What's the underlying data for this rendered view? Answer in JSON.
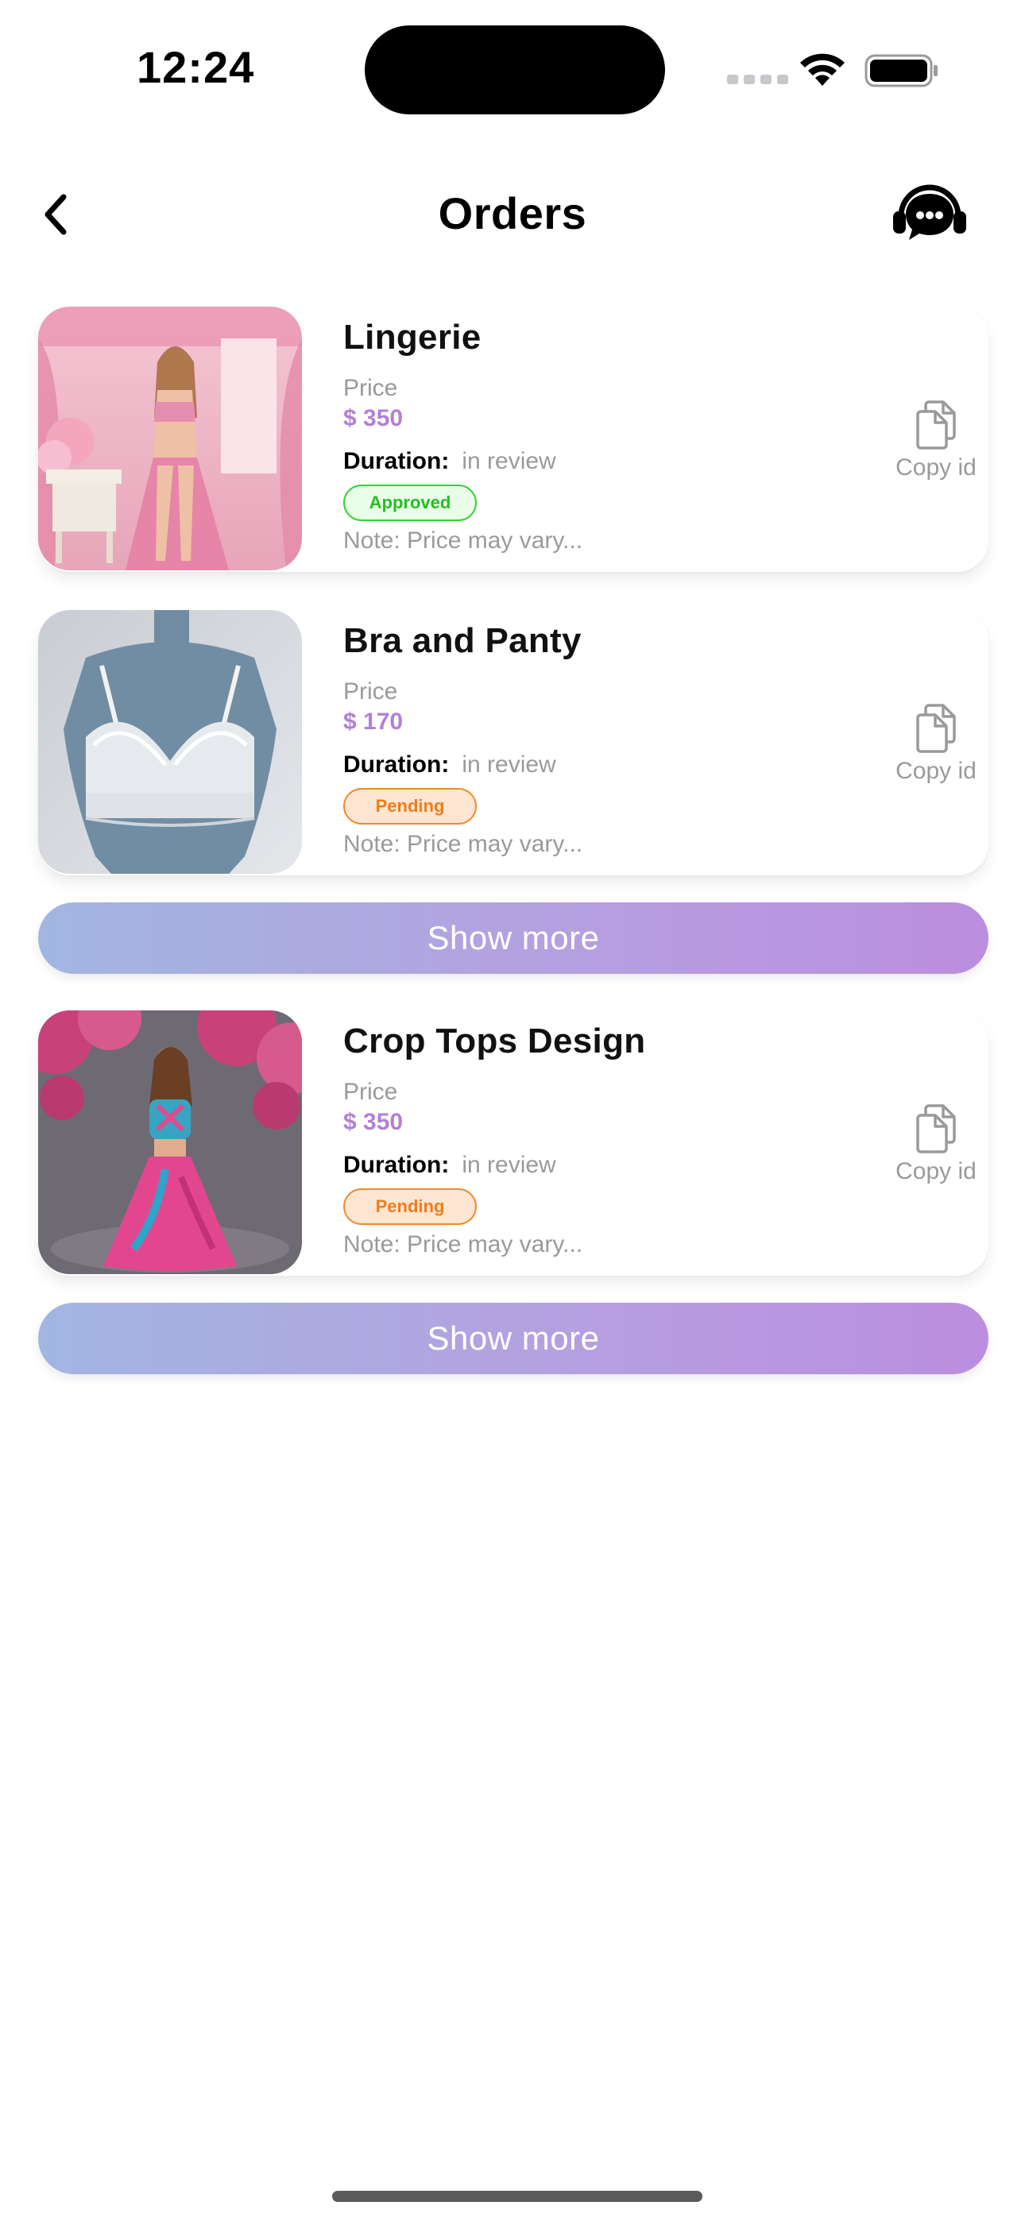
{
  "status_bar": {
    "time": "12:24"
  },
  "header": {
    "title": "Orders"
  },
  "orders": [
    {
      "name": "Lingerie",
      "price_label": "Price",
      "price": "$ 350",
      "duration_label": "Duration:",
      "duration_value": "in review",
      "status": "Approved",
      "note": "Note: Price may vary...",
      "copy_label": "Copy id"
    },
    {
      "name": "Bra and Panty",
      "price_label": "Price",
      "price": "$ 170",
      "duration_label": "Duration:",
      "duration_value": "in review",
      "status": "Pending",
      "note": "Note: Price may vary...",
      "copy_label": "Copy id"
    },
    {
      "name": "Crop Tops Design",
      "price_label": "Price",
      "price": "$ 350",
      "duration_label": "Duration:",
      "duration_value": "in review",
      "status": "Pending",
      "note": "Note: Price may vary...",
      "copy_label": "Copy id"
    }
  ],
  "show_more_label": "Show more",
  "colors": {
    "price": "#b37fd6",
    "approved": "#22c022",
    "pending": "#ef7d1a",
    "button_gradient_start": "#a2b6e2",
    "button_gradient_end": "#bb8edf"
  },
  "icons": {
    "back": "chevron-left-icon",
    "support": "headset-chat-icon",
    "copy": "copy-document-icon"
  }
}
